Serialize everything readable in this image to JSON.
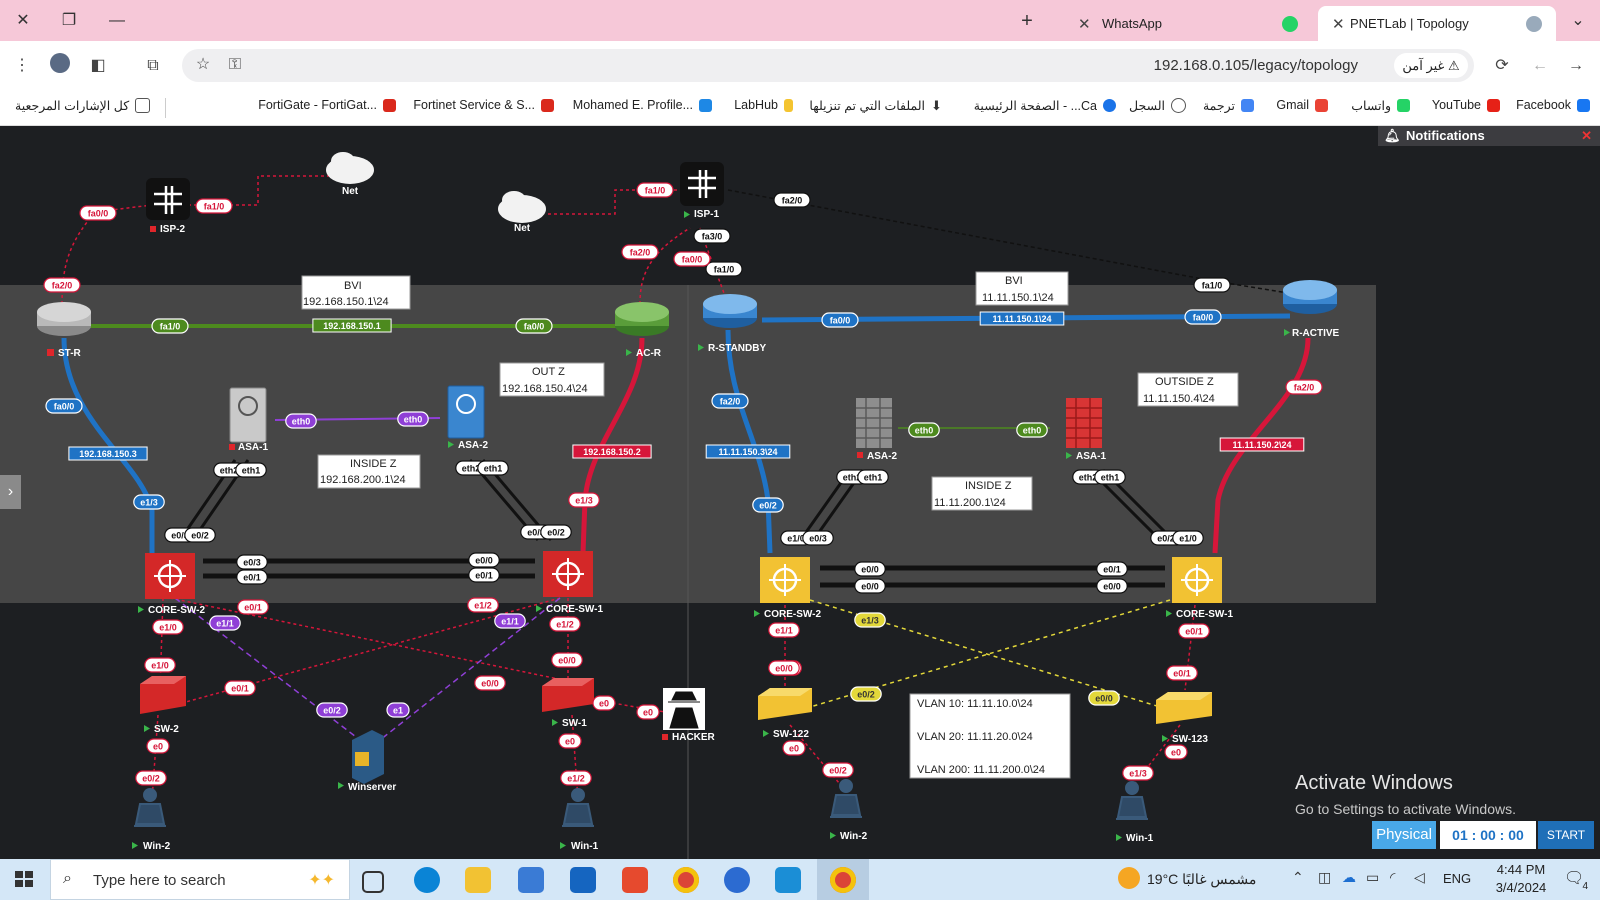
{
  "tabs": [
    {
      "label": "WhatsApp",
      "close": "✕"
    },
    {
      "label": "PNETLab | Topology",
      "close": "✕"
    }
  ],
  "tab_new": "+",
  "address": {
    "url": "192.168.0.105/legacy/topology",
    "security": "غير آمن"
  },
  "bookmarks": [
    {
      "label": "Facebook",
      "color": "#1877f2"
    },
    {
      "label": "YouTube",
      "color": "#e62117"
    },
    {
      "label": "واتساب",
      "color": "#25d366"
    },
    {
      "label": "Gmail",
      "color": "#ea4335"
    },
    {
      "label": "ترجمة",
      "color": "#4285f4"
    },
    {
      "label": "السجل",
      "color": "#555555"
    },
    {
      "label": "الصفحة الرئيسية - ...Ca",
      "color": "#1a73e8"
    },
    {
      "label": "الملفات التي تم تنزيلها",
      "color": "#333333"
    },
    {
      "label": "LabHub",
      "color": "#f4c430"
    },
    {
      "label": "Mohamed E. Profile...",
      "color": "#1e88e5"
    },
    {
      "label": "Fortinet Service & S...",
      "color": "#da291c"
    },
    {
      "label": "FortiGate - FortiGat...",
      "color": "#da291c"
    }
  ],
  "bookmarks_all": "كل الإشارات المرجعية",
  "notifications": {
    "title": "Notifications",
    "close": "✕"
  },
  "topology": {
    "nodes": [
      {
        "id": "isp2",
        "label": "ISP-2",
        "type": "router-dark",
        "status": "stopped"
      },
      {
        "id": "net1",
        "label": "Net",
        "type": "cloud",
        "status": "none"
      },
      {
        "id": "net2",
        "label": "Net",
        "type": "cloud",
        "status": "none"
      },
      {
        "id": "isp1",
        "label": "ISP-1",
        "type": "router-dark",
        "status": "running"
      },
      {
        "id": "str",
        "label": "ST-R",
        "type": "router-grey",
        "status": "stopped"
      },
      {
        "id": "acr",
        "label": "AC-R",
        "type": "router-green",
        "status": "running"
      },
      {
        "id": "rstandby",
        "label": "R-STANDBY",
        "type": "router-blue",
        "status": "running"
      },
      {
        "id": "ractive",
        "label": "R-ACTIVE",
        "type": "router-blue",
        "status": "running"
      },
      {
        "id": "asa1l",
        "label": "ASA-1",
        "type": "asa-grey",
        "status": "stopped"
      },
      {
        "id": "asa2l",
        "label": "ASA-2",
        "type": "asa-blue",
        "status": "running"
      },
      {
        "id": "asa2r",
        "label": "ASA-2",
        "type": "fw-grey",
        "status": "stopped"
      },
      {
        "id": "asa1r",
        "label": "ASA-1",
        "type": "fw-red",
        "status": "running"
      },
      {
        "id": "coresw2l",
        "label": "CORE-SW-2",
        "type": "l3-red",
        "status": "running"
      },
      {
        "id": "coresw1l",
        "label": "CORE-SW-1",
        "type": "l3-red",
        "status": "running"
      },
      {
        "id": "coresw2r",
        "label": "CORE-SW-2",
        "type": "l3-yellow",
        "status": "running"
      },
      {
        "id": "coresw1r",
        "label": "CORE-SW-1",
        "type": "l3-yellow",
        "status": "running"
      },
      {
        "id": "sw2",
        "label": "SW-2",
        "type": "sw-red",
        "status": "running"
      },
      {
        "id": "sw1",
        "label": "SW-1",
        "type": "sw-red",
        "status": "running"
      },
      {
        "id": "sw122",
        "label": "SW-122",
        "type": "sw-yellow",
        "status": "running"
      },
      {
        "id": "sw123",
        "label": "SW-123",
        "type": "sw-yellow",
        "status": "running"
      },
      {
        "id": "winserver",
        "label": "Winserver",
        "type": "server",
        "status": "running"
      },
      {
        "id": "hacker",
        "label": "HACKER",
        "type": "hacker",
        "status": "stopped"
      },
      {
        "id": "win2l",
        "label": "Win-2",
        "type": "pc",
        "status": "running"
      },
      {
        "id": "win1l",
        "label": "Win-1",
        "type": "pc",
        "status": "running"
      },
      {
        "id": "win2r",
        "label": "Win-2",
        "type": "pc",
        "status": "running"
      },
      {
        "id": "win1r",
        "label": "Win-1",
        "type": "pc",
        "status": "running"
      }
    ],
    "text_boxes": [
      {
        "lines": [
          "BVI",
          "192.168.150.1\\24"
        ]
      },
      {
        "lines": [
          "OUT Z",
          "192.168.150.4\\24"
        ]
      },
      {
        "lines": [
          "INSIDE Z",
          "192.168.200.1\\24"
        ]
      },
      {
        "lines": [
          "BVI",
          "11.11.150.1\\24"
        ]
      },
      {
        "lines": [
          "OUTSIDE Z",
          "11.11.150.4\\24"
        ]
      },
      {
        "lines": [
          "INSIDE Z",
          "11.11.200.1\\24"
        ]
      },
      {
        "lines": [
          "VLAN 10: 11.11.10.0\\24",
          "VLAN 20: 11.11.20.0\\24",
          "VLAN 200: 11.11.200.0\\24"
        ]
      }
    ],
    "port_labels": [
      "fa0/0",
      "fa1/0",
      "fa2/0",
      "fa1/0",
      "fa2/0",
      "fa3/0",
      "fa1/0",
      "fa0/0",
      "fa2/0",
      "fa1/0",
      "fa1/0",
      "fa0/0",
      "fa2/0",
      "fa0/0",
      "fa0/0",
      "fa2/0",
      "fa0/0",
      "eth0",
      "eth0",
      "eth0",
      "eth0",
      "eth2",
      "eth1",
      "eth2",
      "eth1",
      "eth2",
      "eth1",
      "eth2",
      "eth1",
      "e1/3",
      "e0/3",
      "e0/2",
      "e1/3",
      "e0/3",
      "e0/2",
      "e0/2",
      "e1/0",
      "e0/3",
      "e0/2",
      "e1/0",
      "e0/3",
      "e0/1",
      "e0/0",
      "e0/1",
      "e0/0",
      "e0/0",
      "e0/1",
      "e0/0",
      "e0/1",
      "e1/0",
      "e1/1",
      "e1/2",
      "e1/1",
      "e1/2",
      "e1/0",
      "e0/0",
      "e0/1",
      "e0/0",
      "e0/1",
      "e0/3",
      "e0",
      "e0",
      "e1",
      "e0/2",
      "e0",
      "e0/2",
      "e0",
      "e1/2",
      "e1/1",
      "e0/1",
      "e0/0",
      "e0/1",
      "e0/0",
      "e0/2",
      "e0",
      "e0/2",
      "e0",
      "e1/3",
      "e1/3"
    ],
    "link_labels": [
      "192.168.150.1",
      "192.168.150.3",
      "192.168.150.2",
      "11.11.150.1\\24",
      "11.11.150.3\\24",
      "11.11.150.2\\24"
    ]
  },
  "lab_controls": {
    "mode": "Physical",
    "hours": "01",
    "minutes": "00",
    "seconds": "00",
    "start": "START"
  },
  "activate": {
    "title": "Activate Windows",
    "subtitle": "Go to Settings to activate Windows."
  },
  "taskbar": {
    "search_placeholder": "Type here to search",
    "weather": "19°C مشمس غالبًا",
    "lang": "ENG",
    "time": "4:44 PM",
    "date": "3/4/2024",
    "notif_count": "4"
  },
  "colors": {
    "red": "#d6163a",
    "blue": "#1f73c5",
    "green": "#4d8a1e",
    "purple": "#8f3fd6",
    "yellow": "#e3d83a",
    "lan_grey": "#464646"
  }
}
